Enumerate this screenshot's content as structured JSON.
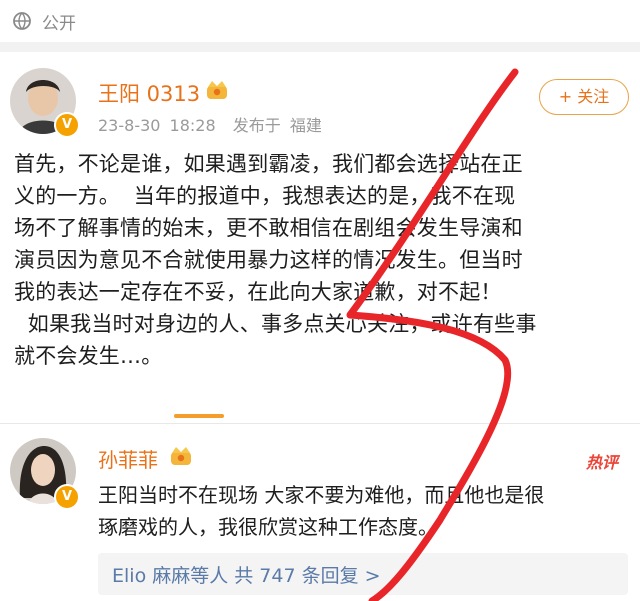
{
  "visibility": {
    "label": "公开"
  },
  "post": {
    "username": "王阳 0313",
    "time": "23-8-30 18:28",
    "location": "发布于 福建",
    "follow_label": "+ 关注",
    "lines": [
      "首先，不论是谁，如果遇到霸凌，我们都会选择站在正",
      "义的一方。  当年的报道中，我想表达的是，我不在现",
      "场不了解事情的始末，更不敢相信在剧组会发生导演和",
      "演员因为意见不合就使用暴力这样的情况发生。但当时",
      "我的表达一定存在不妥，在此向大家道歉，对不起！",
      "  如果我当时对身边的人、事多点关心关注，或许有些事",
      "就不会发生…。"
    ]
  },
  "comment": {
    "username": "孙菲菲",
    "hot_label": "热评",
    "lines": [
      "王阳当时不在现场 大家不要为难他，而且他也是很",
      "琢磨戏的人，我很欣赏这种工作态度。"
    ],
    "replies_summary": "Elio 麻麻等人  共 747 条回复 >"
  },
  "colors": {
    "accent": "#e8721a",
    "hot": "#e94539",
    "reply_link": "#5a7aa8",
    "annotation": "#e8262a"
  }
}
